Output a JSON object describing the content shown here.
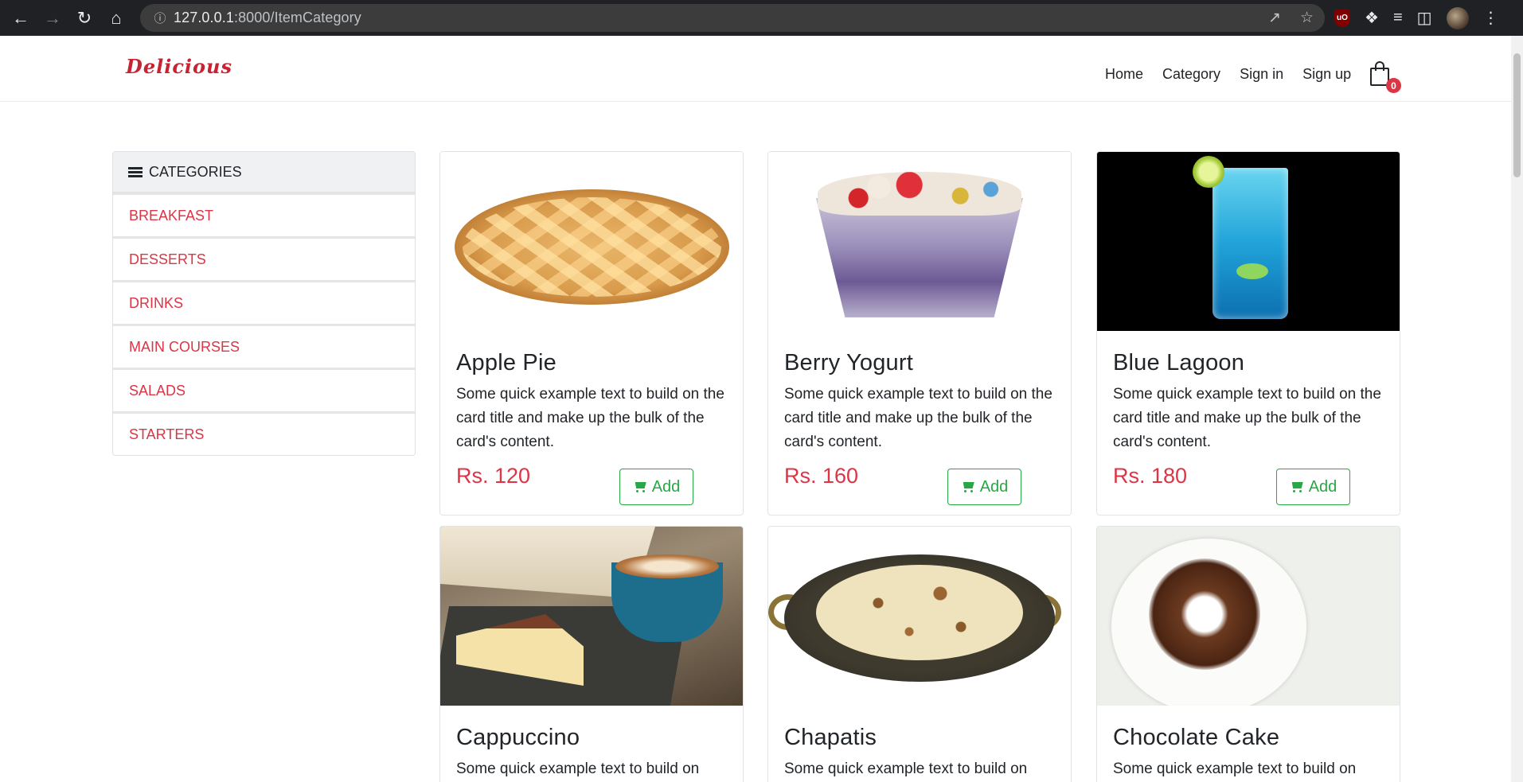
{
  "browser": {
    "url_host": "127.0.0.1",
    "url_rest": ":8000/ItemCategory"
  },
  "navbar": {
    "brand": "Delicious",
    "links": [
      "Home",
      "Category",
      "Sign in",
      "Sign up"
    ],
    "cart_count": "0"
  },
  "categories": {
    "header": "CATEGORIES",
    "items": [
      "BREAKFAST",
      "DESSERTS",
      "DRINKS",
      "MAIN COURSES",
      "SALADS",
      "STARTERS"
    ]
  },
  "products": [
    {
      "name": "Apple Pie",
      "description": "Some quick example text to build on the card title and make up the bulk of the card's content.",
      "price": "Rs. 120",
      "button": "Add"
    },
    {
      "name": "Berry Yogurt",
      "description": "Some quick example text to build on the card title and make up the bulk of the card's content.",
      "price": "Rs. 160",
      "button": "Add"
    },
    {
      "name": "Blue Lagoon",
      "description": "Some quick example text to build on the card title and make up the bulk of the card's content.",
      "price": "Rs. 180",
      "button": "Add"
    },
    {
      "name": "Cappuccino",
      "description": "Some quick example text to build on"
    },
    {
      "name": "Chapatis",
      "description": "Some quick example text to build on"
    },
    {
      "name": "Chocolate Cake",
      "description": "Some quick example text to build on"
    }
  ],
  "colors": {
    "brand": "#c82333",
    "category_link": "#dc3545",
    "price": "#dc3545",
    "add_button": "#28a745",
    "chrome_bg": "#202124"
  }
}
